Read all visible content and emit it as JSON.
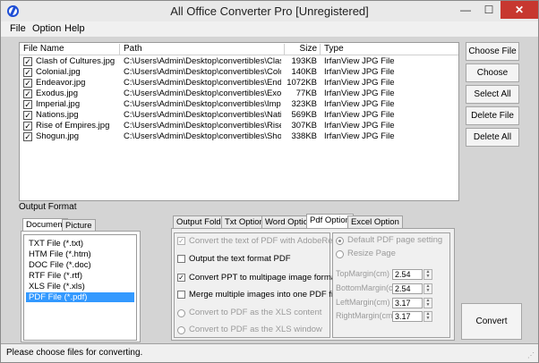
{
  "window": {
    "title": "All Office Converter Pro [Unregistered]",
    "minimize_glyph": "—",
    "maximize_glyph": "☐",
    "close_glyph": "✕"
  },
  "menu": [
    "File",
    "Option",
    "Help"
  ],
  "file_list": {
    "columns": [
      "File Name",
      "Path",
      "Size",
      "Type"
    ],
    "rows": [
      {
        "name": "Clash of Cultures.jpg",
        "path": "C:\\Users\\Admin\\Desktop\\convertibles\\Clas...",
        "size": "193KB",
        "type": "IrfanView JPG File"
      },
      {
        "name": "Colonial.jpg",
        "path": "C:\\Users\\Admin\\Desktop\\convertibles\\Colo...",
        "size": "140KB",
        "type": "IrfanView JPG File"
      },
      {
        "name": "Endeavor.jpg",
        "path": "C:\\Users\\Admin\\Desktop\\convertibles\\End...",
        "size": "1072KB",
        "type": "IrfanView JPG File"
      },
      {
        "name": "Exodus.jpg",
        "path": "C:\\Users\\Admin\\Desktop\\convertibles\\Exo...",
        "size": "77KB",
        "type": "IrfanView JPG File"
      },
      {
        "name": "Imperial.jpg",
        "path": "C:\\Users\\Admin\\Desktop\\convertibles\\Imp...",
        "size": "323KB",
        "type": "IrfanView JPG File"
      },
      {
        "name": "Nations.jpg",
        "path": "C:\\Users\\Admin\\Desktop\\convertibles\\Nati...",
        "size": "569KB",
        "type": "IrfanView JPG File"
      },
      {
        "name": "Rise of Empires.jpg",
        "path": "C:\\Users\\Admin\\Desktop\\convertibles\\Rise...",
        "size": "307KB",
        "type": "IrfanView JPG File"
      },
      {
        "name": "Shogun.jpg",
        "path": "C:\\Users\\Admin\\Desktop\\convertibles\\Sho...",
        "size": "338KB",
        "type": "IrfanView JPG File"
      }
    ]
  },
  "side_buttons": {
    "choose_file": "Choose File",
    "choose_folder": "Choose Folder",
    "select_all": "Select All",
    "delete_file": "Delete File",
    "delete_all": "Delete All"
  },
  "output_format": {
    "label": "Output Format",
    "tabs": [
      "Document",
      "Picture"
    ],
    "items": [
      "TXT File  (*.txt)",
      "HTM File  (*.htm)",
      "DOC File  (*.doc)",
      "RTF File  (*.rtf)",
      "XLS File  (*.xls)",
      "PDF File  (*.pdf)"
    ],
    "selected": "PDF File  (*.pdf)"
  },
  "option_tabs": [
    "Output Folder",
    "Txt Option",
    "Word Option",
    "Pdf Option",
    "Excel Option"
  ],
  "active_option_tab": "Pdf Option",
  "pdf_options": [
    {
      "label": "Convert the text of PDF with AdobeReader",
      "checked": true,
      "disabled": true
    },
    {
      "label": "Output the text format PDF",
      "checked": false,
      "disabled": false
    },
    {
      "label": "Convert PPT to multipage image format PDF",
      "checked": true,
      "disabled": false
    },
    {
      "label": "Merge multiple images into one PDF file",
      "checked": false,
      "disabled": false
    }
  ],
  "pdf_radios": [
    {
      "label": "Convert to PDF as the XLS content"
    },
    {
      "label": "Convert to PDF as the XLS window"
    }
  ],
  "page_setting": {
    "default_label": "Default PDF page setting",
    "resize_label": "Resize Page",
    "margins": [
      {
        "label": "TopMargin(cm)",
        "value": "2.54"
      },
      {
        "label": "BottomMargin(cm)",
        "value": "2.54"
      },
      {
        "label": "LeftMargin(cm)",
        "value": "3.17"
      },
      {
        "label": "RightMargin(cm)",
        "value": "3.17"
      }
    ]
  },
  "convert_label": "Convert",
  "status": "Please choose files for converting.",
  "check_glyph": "✓",
  "spin_up": "▲",
  "spin_down": "▼",
  "grip_glyph": "⋰"
}
